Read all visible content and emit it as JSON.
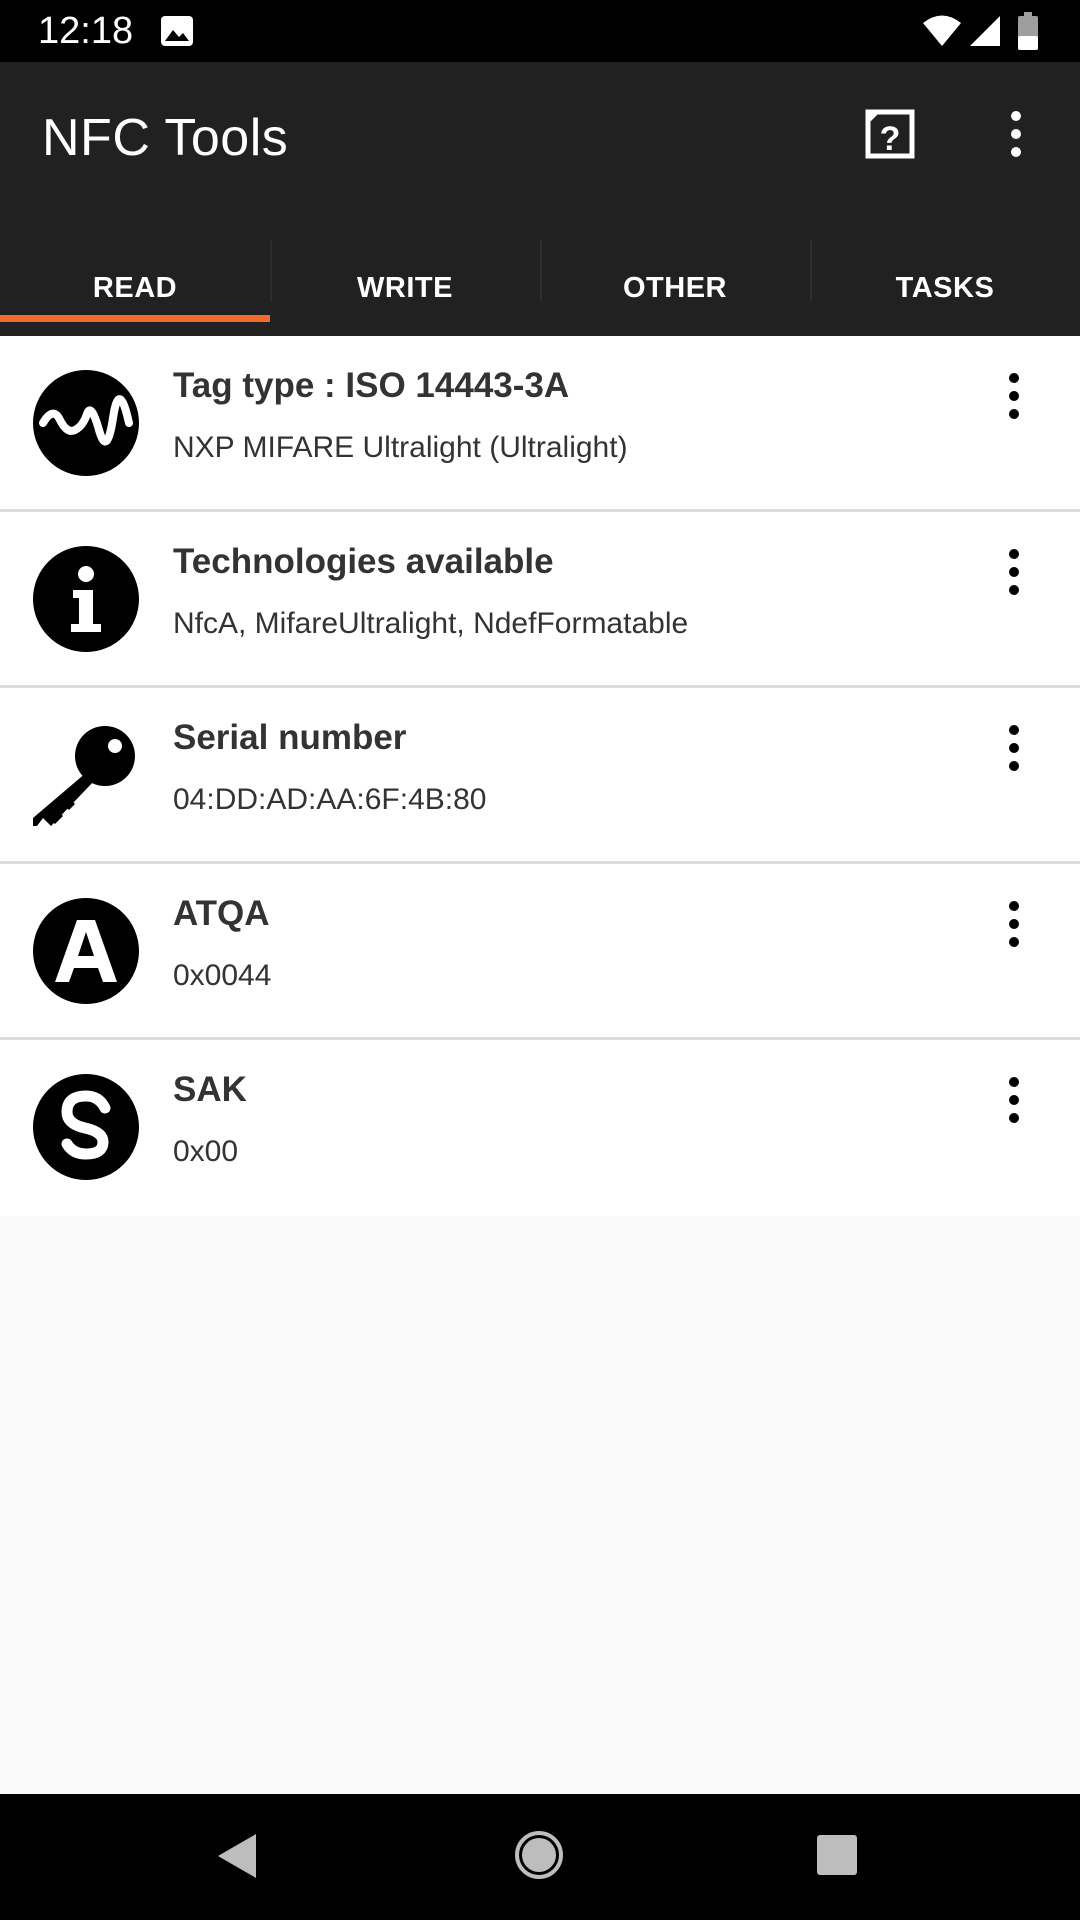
{
  "status_bar": {
    "time": "12:18",
    "icons": [
      "photo-icon",
      "wifi-icon",
      "signal-icon",
      "battery-icon"
    ]
  },
  "app_bar": {
    "title": "NFC Tools",
    "actions": [
      "help-icon",
      "more-vert-icon"
    ]
  },
  "tabs": [
    {
      "label": "READ",
      "active": true
    },
    {
      "label": "WRITE",
      "active": false
    },
    {
      "label": "OTHER",
      "active": false
    },
    {
      "label": "TASKS",
      "active": false
    }
  ],
  "colors": {
    "app_bar": "#212121",
    "accent": "#f26b2a",
    "list_text": "#333333"
  },
  "records": [
    {
      "icon": "waveform-icon",
      "title": "Tag type : ISO 14443-3A",
      "value": "NXP MIFARE Ultralight (Ultralight)"
    },
    {
      "icon": "info-icon",
      "title": "Technologies available",
      "value": "NfcA, MifareUltralight, NdefFormatable"
    },
    {
      "icon": "key-icon",
      "title": "Serial number",
      "value": "04:DD:AD:AA:6F:4B:80"
    },
    {
      "icon": "letter-a-icon",
      "title": "ATQA",
      "value": "0x0044"
    },
    {
      "icon": "letter-s-icon",
      "title": "SAK",
      "value": "0x00"
    }
  ],
  "nav_bar": {
    "buttons": [
      "back-icon",
      "home-icon",
      "recents-icon"
    ]
  }
}
